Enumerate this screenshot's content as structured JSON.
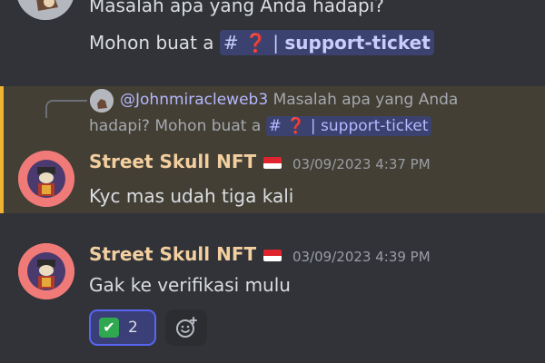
{
  "messages": [
    {
      "lines": [
        "Masalah apa yang Anda hadapi?",
        "Mohon buat a"
      ],
      "channel_mention": {
        "hash": "#",
        "emoji": "❓",
        "separator": "|",
        "name": "support-ticket"
      }
    },
    {
      "reply": {
        "username": "@Johnmiracleweb3",
        "text_line1": "Masalah apa yang Anda",
        "text_line2": "hadapi? Mohon buat a",
        "channel_mention": {
          "hash": "#",
          "emoji": "❓",
          "separator": "|",
          "name": "support-ticket"
        }
      },
      "username": "Street Skull NFT",
      "timestamp": "03/09/2023 4:37 PM",
      "text": "Kyc mas udah tiga kali",
      "highlighted": true
    },
    {
      "username": "Street Skull NFT",
      "timestamp": "03/09/2023 4:39 PM",
      "text": "Gak ke verifikasi mulu",
      "reaction": {
        "emoji": "✔",
        "count": "2"
      }
    }
  ],
  "colors": {
    "background": "#313338",
    "highlight": "#433f35",
    "highlight_bar": "#f0b232",
    "username": "#f3cfa0",
    "mention": "#c9cdfb",
    "reaction_border": "#5865f2"
  },
  "icons": {
    "flag": "indonesia-flag-icon",
    "reaction": "check-mark-button-icon",
    "add_reaction": "add-reaction-icon"
  }
}
